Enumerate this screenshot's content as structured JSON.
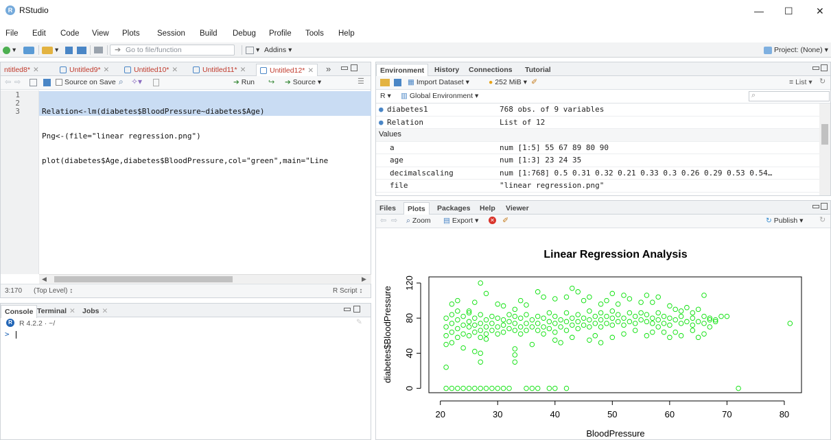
{
  "app": {
    "title": "RStudio"
  },
  "window_controls": {
    "minimize": "—",
    "maximize": "☐",
    "close": "✕"
  },
  "menu": [
    "File",
    "Edit",
    "Code",
    "View",
    "Plots",
    "Session",
    "Build",
    "Debug",
    "Profile",
    "Tools",
    "Help"
  ],
  "toolbar": {
    "goto": "Go to file/function",
    "addins": "Addins",
    "project": "Project: (None)"
  },
  "editor": {
    "tabs": [
      {
        "label": "ntitled8*"
      },
      {
        "label": "Untitled9*"
      },
      {
        "label": "Untitled10*"
      },
      {
        "label": "Untitled11*"
      },
      {
        "label": "Untitled12*"
      }
    ],
    "source_on_save": "Source on Save",
    "run": "Run",
    "source": "Source",
    "line_numbers": [
      "1",
      "2",
      "3"
    ],
    "lines": [
      "Relation<-lm(diabetes$BloodPressure~diabetes$Age)",
      "Png<-(file=\"linear regression.png\")",
      "plot(diabetes$Age,diabetes$BloodPressure,col=\"green\",main=\"Line"
    ],
    "status_pos": "3:170",
    "status_scope": "(Top Level) ↕",
    "status_type": "R Script ↕"
  },
  "console": {
    "tabs": [
      "Console",
      "Terminal",
      "Jobs"
    ],
    "version": "R 4.2.2 · ~/",
    "prompt": ">"
  },
  "environment": {
    "tabs": [
      "Environment",
      "History",
      "Connections",
      "Tutorial"
    ],
    "import": "Import Dataset",
    "memory": "252 MiB",
    "list": "List",
    "r_label": "R",
    "scope": "Global Environment",
    "rows": [
      {
        "name": "diabetes1",
        "value": "768 obs. of 9 variables",
        "kind": "data"
      },
      {
        "name": "Relation",
        "value": "List of  12",
        "kind": "data"
      },
      {
        "name": "Values",
        "value": "",
        "kind": "header"
      },
      {
        "name": "a",
        "value": "num [1:5] 55 67 89 80 90",
        "kind": "value"
      },
      {
        "name": "age",
        "value": "num [1:3] 23 24 35",
        "kind": "value"
      },
      {
        "name": "decimalscaling",
        "value": "num [1:768] 0.5 0.31 0.32 0.21 0.33 0.3 0.26 0.29 0.53 0.54…",
        "kind": "value"
      },
      {
        "name": "file",
        "value": "\"linear regression.png\"",
        "kind": "value"
      }
    ]
  },
  "files": {
    "tabs": [
      "Files",
      "Plots",
      "Packages",
      "Help",
      "Viewer"
    ],
    "zoom": "Zoom",
    "export": "Export",
    "publish": "Publish"
  },
  "colors": {
    "accent": "#4a86c6",
    "point": "#00e000",
    "selection": "#c9dcf3",
    "red_tab": "#c0392b"
  },
  "chart_data": {
    "type": "scatter",
    "title": "Linear Regression Analysis",
    "xlabel": "BloodPressure",
    "ylabel": "diabetes$BloodPressure",
    "xlim": [
      18,
      83
    ],
    "ylim": [
      -5,
      127
    ],
    "xticks": [
      20,
      30,
      40,
      50,
      60,
      70,
      80
    ],
    "yticks": [
      0,
      40,
      80,
      120
    ],
    "color": "#00e000",
    "points": [
      [
        21,
        0
      ],
      [
        22,
        0
      ],
      [
        23,
        0
      ],
      [
        24,
        0
      ],
      [
        25,
        0
      ],
      [
        26,
        0
      ],
      [
        27,
        0
      ],
      [
        28,
        0
      ],
      [
        29,
        0
      ],
      [
        30,
        0
      ],
      [
        31,
        0
      ],
      [
        32,
        0
      ],
      [
        35,
        0
      ],
      [
        36,
        0
      ],
      [
        37,
        0
      ],
      [
        39,
        0
      ],
      [
        40,
        0
      ],
      [
        42,
        0
      ],
      [
        72,
        0
      ],
      [
        21,
        24
      ],
      [
        27,
        30
      ],
      [
        33,
        30
      ],
      [
        21,
        50
      ],
      [
        22,
        52
      ],
      [
        24,
        46
      ],
      [
        26,
        42
      ],
      [
        27,
        40
      ],
      [
        28,
        56
      ],
      [
        33,
        38
      ],
      [
        33,
        45
      ],
      [
        36,
        50
      ],
      [
        38,
        62
      ],
      [
        40,
        55
      ],
      [
        41,
        52
      ],
      [
        43,
        58
      ],
      [
        46,
        55
      ],
      [
        47,
        60
      ],
      [
        48,
        52
      ],
      [
        50,
        58
      ],
      [
        52,
        62
      ],
      [
        54,
        66
      ],
      [
        56,
        60
      ],
      [
        57,
        64
      ],
      [
        58,
        70
      ],
      [
        59,
        64
      ],
      [
        60,
        58
      ],
      [
        61,
        64
      ],
      [
        62,
        60
      ],
      [
        64,
        66
      ],
      [
        65,
        58
      ],
      [
        66,
        62
      ],
      [
        67,
        70
      ],
      [
        68,
        78
      ],
      [
        69,
        82
      ],
      [
        70,
        82
      ],
      [
        81,
        74
      ],
      [
        22,
        96
      ],
      [
        23,
        100
      ],
      [
        25,
        88
      ],
      [
        26,
        98
      ],
      [
        27,
        120
      ],
      [
        28,
        108
      ],
      [
        30,
        96
      ],
      [
        31,
        94
      ],
      [
        33,
        90
      ],
      [
        34,
        100
      ],
      [
        35,
        95
      ],
      [
        37,
        110
      ],
      [
        38,
        104
      ],
      [
        40,
        102
      ],
      [
        42,
        104
      ],
      [
        43,
        114
      ],
      [
        44,
        110
      ],
      [
        45,
        100
      ],
      [
        46,
        104
      ],
      [
        48,
        96
      ],
      [
        49,
        100
      ],
      [
        50,
        108
      ],
      [
        51,
        96
      ],
      [
        52,
        106
      ],
      [
        53,
        102
      ],
      [
        55,
        98
      ],
      [
        56,
        106
      ],
      [
        57,
        98
      ],
      [
        58,
        104
      ],
      [
        60,
        94
      ],
      [
        61,
        90
      ],
      [
        62,
        88
      ],
      [
        63,
        92
      ],
      [
        64,
        86
      ],
      [
        65,
        90
      ],
      [
        66,
        106
      ],
      [
        67,
        80
      ],
      [
        21,
        60
      ],
      [
        21,
        70
      ],
      [
        21,
        80
      ],
      [
        22,
        64
      ],
      [
        22,
        74
      ],
      [
        22,
        84
      ],
      [
        23,
        58
      ],
      [
        23,
        68
      ],
      [
        23,
        78
      ],
      [
        23,
        88
      ],
      [
        24,
        62
      ],
      [
        24,
        72
      ],
      [
        24,
        82
      ],
      [
        25,
        60
      ],
      [
        25,
        70
      ],
      [
        25,
        76
      ],
      [
        25,
        86
      ],
      [
        26,
        64
      ],
      [
        26,
        72
      ],
      [
        26,
        80
      ],
      [
        27,
        58
      ],
      [
        27,
        66
      ],
      [
        27,
        74
      ],
      [
        27,
        84
      ],
      [
        28,
        62
      ],
      [
        28,
        70
      ],
      [
        28,
        78
      ],
      [
        29,
        66
      ],
      [
        29,
        74
      ],
      [
        29,
        82
      ],
      [
        30,
        62
      ],
      [
        30,
        70
      ],
      [
        30,
        80
      ],
      [
        31,
        64
      ],
      [
        31,
        72
      ],
      [
        31,
        78
      ],
      [
        32,
        68
      ],
      [
        32,
        76
      ],
      [
        32,
        84
      ],
      [
        33,
        66
      ],
      [
        33,
        74
      ],
      [
        33,
        82
      ],
      [
        34,
        62
      ],
      [
        34,
        70
      ],
      [
        34,
        80
      ],
      [
        35,
        66
      ],
      [
        35,
        74
      ],
      [
        35,
        84
      ],
      [
        36,
        70
      ],
      [
        36,
        78
      ],
      [
        37,
        66
      ],
      [
        37,
        74
      ],
      [
        37,
        82
      ],
      [
        38,
        70
      ],
      [
        38,
        80
      ],
      [
        39,
        68
      ],
      [
        39,
        76
      ],
      [
        39,
        86
      ],
      [
        40,
        64
      ],
      [
        40,
        74
      ],
      [
        40,
        82
      ],
      [
        41,
        70
      ],
      [
        41,
        78
      ],
      [
        42,
        66
      ],
      [
        42,
        76
      ],
      [
        42,
        86
      ],
      [
        43,
        72
      ],
      [
        43,
        80
      ],
      [
        44,
        68
      ],
      [
        44,
        76
      ],
      [
        44,
        84
      ],
      [
        45,
        72
      ],
      [
        45,
        80
      ],
      [
        46,
        70
      ],
      [
        46,
        78
      ],
      [
        46,
        88
      ],
      [
        47,
        74
      ],
      [
        47,
        82
      ],
      [
        48,
        70
      ],
      [
        48,
        78
      ],
      [
        48,
        86
      ],
      [
        49,
        74
      ],
      [
        49,
        82
      ],
      [
        50,
        72
      ],
      [
        50,
        80
      ],
      [
        50,
        88
      ],
      [
        51,
        76
      ],
      [
        51,
        84
      ],
      [
        52,
        72
      ],
      [
        52,
        80
      ],
      [
        53,
        76
      ],
      [
        53,
        86
      ],
      [
        54,
        74
      ],
      [
        54,
        82
      ],
      [
        55,
        78
      ],
      [
        55,
        86
      ],
      [
        56,
        76
      ],
      [
        56,
        84
      ],
      [
        57,
        74
      ],
      [
        57,
        80
      ],
      [
        58,
        78
      ],
      [
        58,
        86
      ],
      [
        59,
        74
      ],
      [
        59,
        82
      ],
      [
        60,
        72
      ],
      [
        60,
        80
      ],
      [
        61,
        78
      ],
      [
        62,
        74
      ],
      [
        62,
        82
      ],
      [
        63,
        76
      ],
      [
        64,
        72
      ],
      [
        64,
        80
      ],
      [
        65,
        76
      ],
      [
        66,
        74
      ],
      [
        66,
        82
      ],
      [
        67,
        78
      ],
      [
        68,
        76
      ]
    ]
  }
}
